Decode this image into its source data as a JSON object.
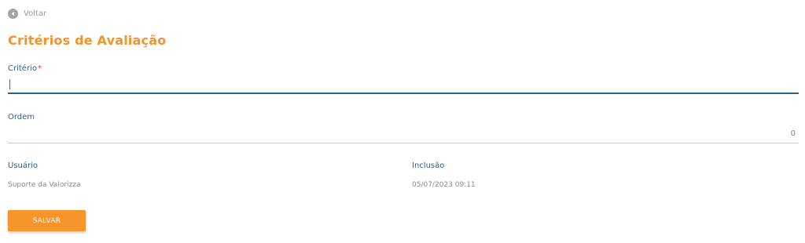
{
  "nav": {
    "back_label": "Voltar",
    "back_icon": "arrow-left-circle-icon"
  },
  "page": {
    "title": "Critérios de Avaliação"
  },
  "form": {
    "criterio": {
      "label": "Critério",
      "required_mark": "*",
      "value": ""
    },
    "ordem": {
      "label": "Ordem",
      "value": "0"
    }
  },
  "info": {
    "usuario": {
      "label": "Usuário",
      "value": "Suporte da Valorizza"
    },
    "inclusao": {
      "label": "Inclusão",
      "value": "05/07/2023 09:11"
    }
  },
  "actions": {
    "save_label": "SALVAR"
  },
  "colors": {
    "accent": "#f5932a",
    "label_blue": "#2a6193",
    "muted_text": "#8a8a8a",
    "required_red": "#e53935"
  }
}
